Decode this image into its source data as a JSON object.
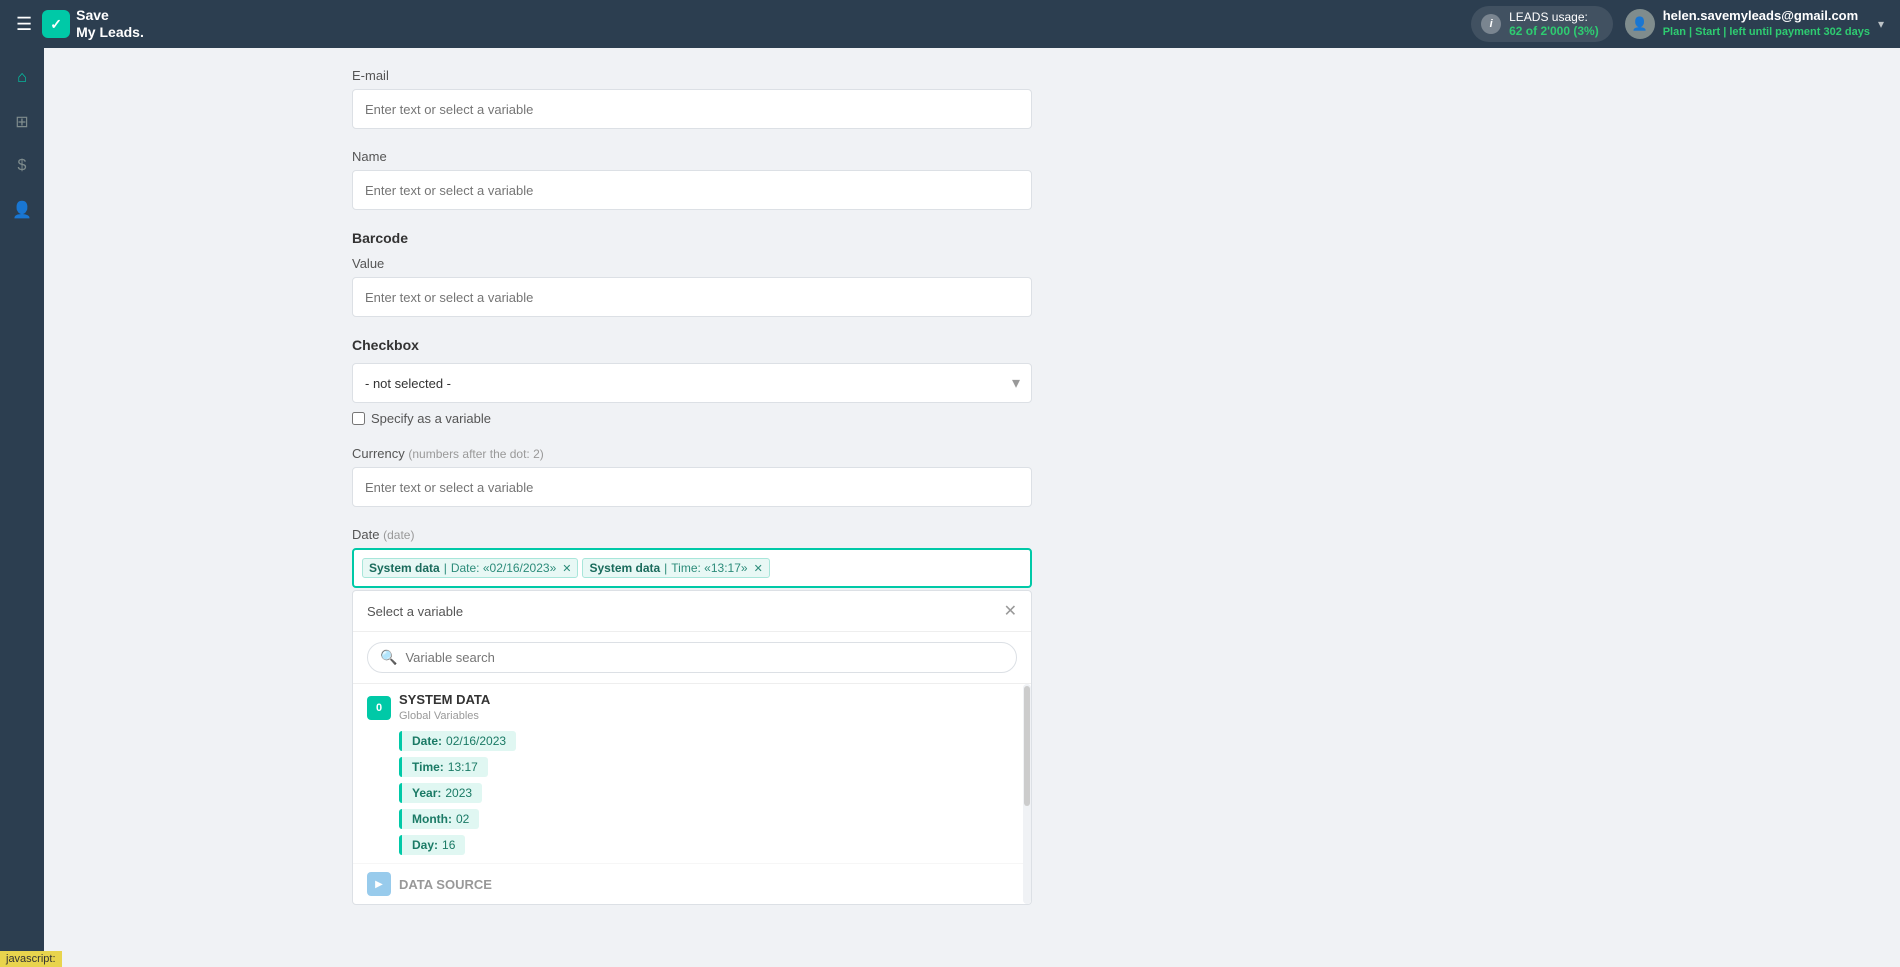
{
  "navbar": {
    "menu_icon": "☰",
    "logo_check": "✓",
    "logo_line1": "Save",
    "logo_line2": "My Leads.",
    "leads_usage_label": "LEADS usage:",
    "leads_count": "62 of 2'000 (3%)",
    "info_icon": "i",
    "user_email": "helen.savemyleads@gmail.com",
    "user_plan": "Plan | Start | left until payment",
    "user_days": "302 days",
    "chevron": "▾"
  },
  "sidebar": {
    "items": [
      {
        "icon": "⌂",
        "name": "home"
      },
      {
        "icon": "⊞",
        "name": "integrations"
      },
      {
        "icon": "$",
        "name": "billing"
      },
      {
        "icon": "👤",
        "name": "account"
      }
    ]
  },
  "form": {
    "email_label": "E-mail",
    "email_placeholder": "Enter text or select a variable",
    "name_label": "Name",
    "name_placeholder": "Enter text or select a variable",
    "barcode_section": "Barcode",
    "value_label": "Value",
    "value_placeholder": "Enter text or select a variable",
    "checkbox_section": "Checkbox",
    "checkbox_default": "- not selected -",
    "specify_variable_label": "Specify as a variable",
    "currency_label": "Currency",
    "currency_sublabel": "(numbers after the dot: 2)",
    "currency_placeholder": "Enter text or select a variable",
    "date_label": "Date",
    "date_sublabel": "(date)",
    "tag1_keyword": "System data",
    "tag1_pipe": " | ",
    "tag1_value": "Date: «02/16/2023»",
    "tag2_keyword": "System data",
    "tag2_pipe": " | ",
    "tag2_value": "Time: «13:17»",
    "selector_title": "Select a variable",
    "search_placeholder": "Variable search",
    "system_data_badge": "0",
    "system_data_name": "SYSTEM DATA",
    "system_data_subtitle": "Global Variables",
    "variables": [
      {
        "key": "Date:",
        "value": "02/16/2023"
      },
      {
        "key": "Time:",
        "value": "13:17"
      },
      {
        "key": "Year:",
        "value": "2023"
      },
      {
        "key": "Month:",
        "value": "02"
      },
      {
        "key": "Day:",
        "value": "16"
      }
    ],
    "data_source_badge": "▶",
    "data_source_name": "DATA SOURCE"
  },
  "js_badge": "javascript:"
}
